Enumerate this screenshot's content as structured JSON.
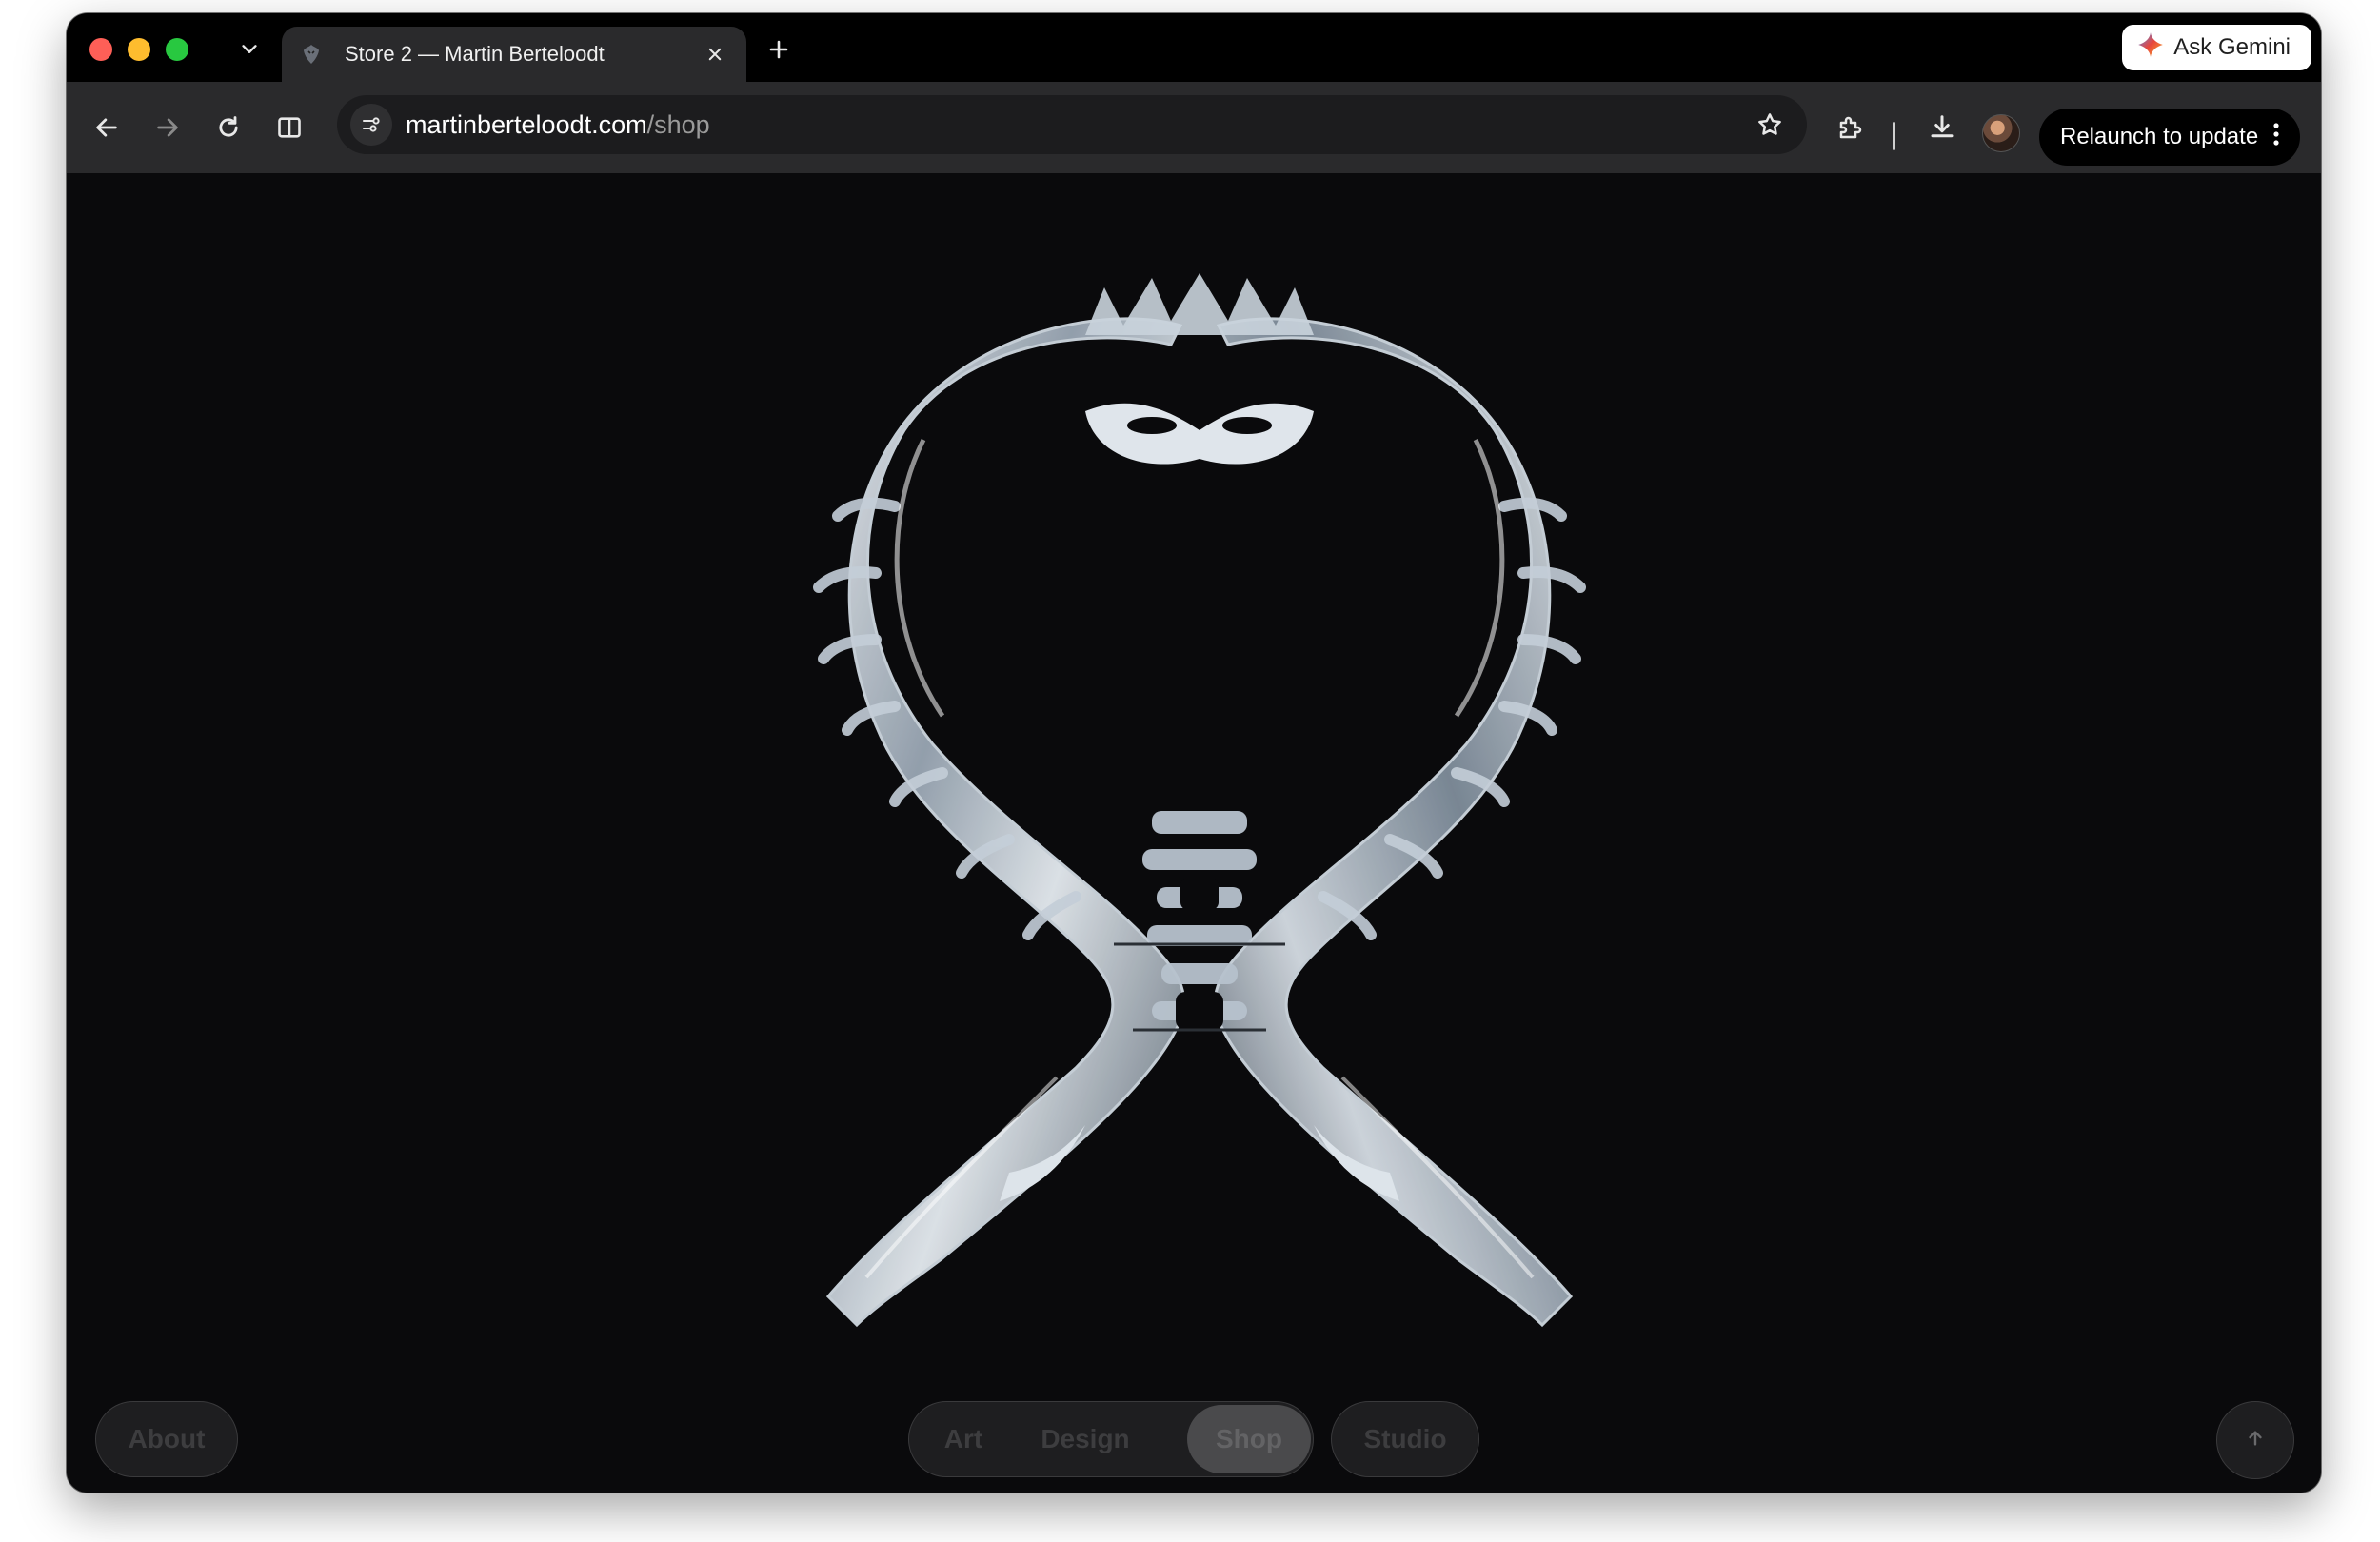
{
  "browser": {
    "tab": {
      "title": "Store 2 — Martin Berteloodt",
      "favicon": "vampire-logo-icon"
    },
    "gemini_button": {
      "label": "Ask Gemini",
      "icon": "gemini-sparkle-icon"
    },
    "address_bar": {
      "domain": "martinberteloodt.com",
      "path": "/shop"
    },
    "relaunch_button": {
      "label": "Relaunch to update"
    },
    "icons": [
      "chevron-down-icon",
      "close-icon",
      "plus-icon",
      "back-arrow-icon",
      "forward-arrow-icon",
      "reload-icon",
      "split-view-icon",
      "site-info-icon",
      "star-icon",
      "extensions-icon",
      "download-icon",
      "avatar",
      "kebab-menu-icon"
    ]
  },
  "page": {
    "hero": {
      "subject": "clear-crystal-ribbon-sculpture"
    },
    "nav": {
      "about": "About",
      "items": [
        {
          "label": "Art",
          "active": false
        },
        {
          "label": "Design",
          "active": false
        },
        {
          "label": "Shop",
          "active": true
        }
      ],
      "studio": "Studio",
      "scroll_top_icon": "arrow-up-icon"
    }
  },
  "colors": {
    "page_background": "#0a0a0c",
    "toolbar": "#2a2a2c",
    "traffic_red": "#fe5f57",
    "traffic_yellow": "#febc2e",
    "traffic_green": "#28c840"
  }
}
